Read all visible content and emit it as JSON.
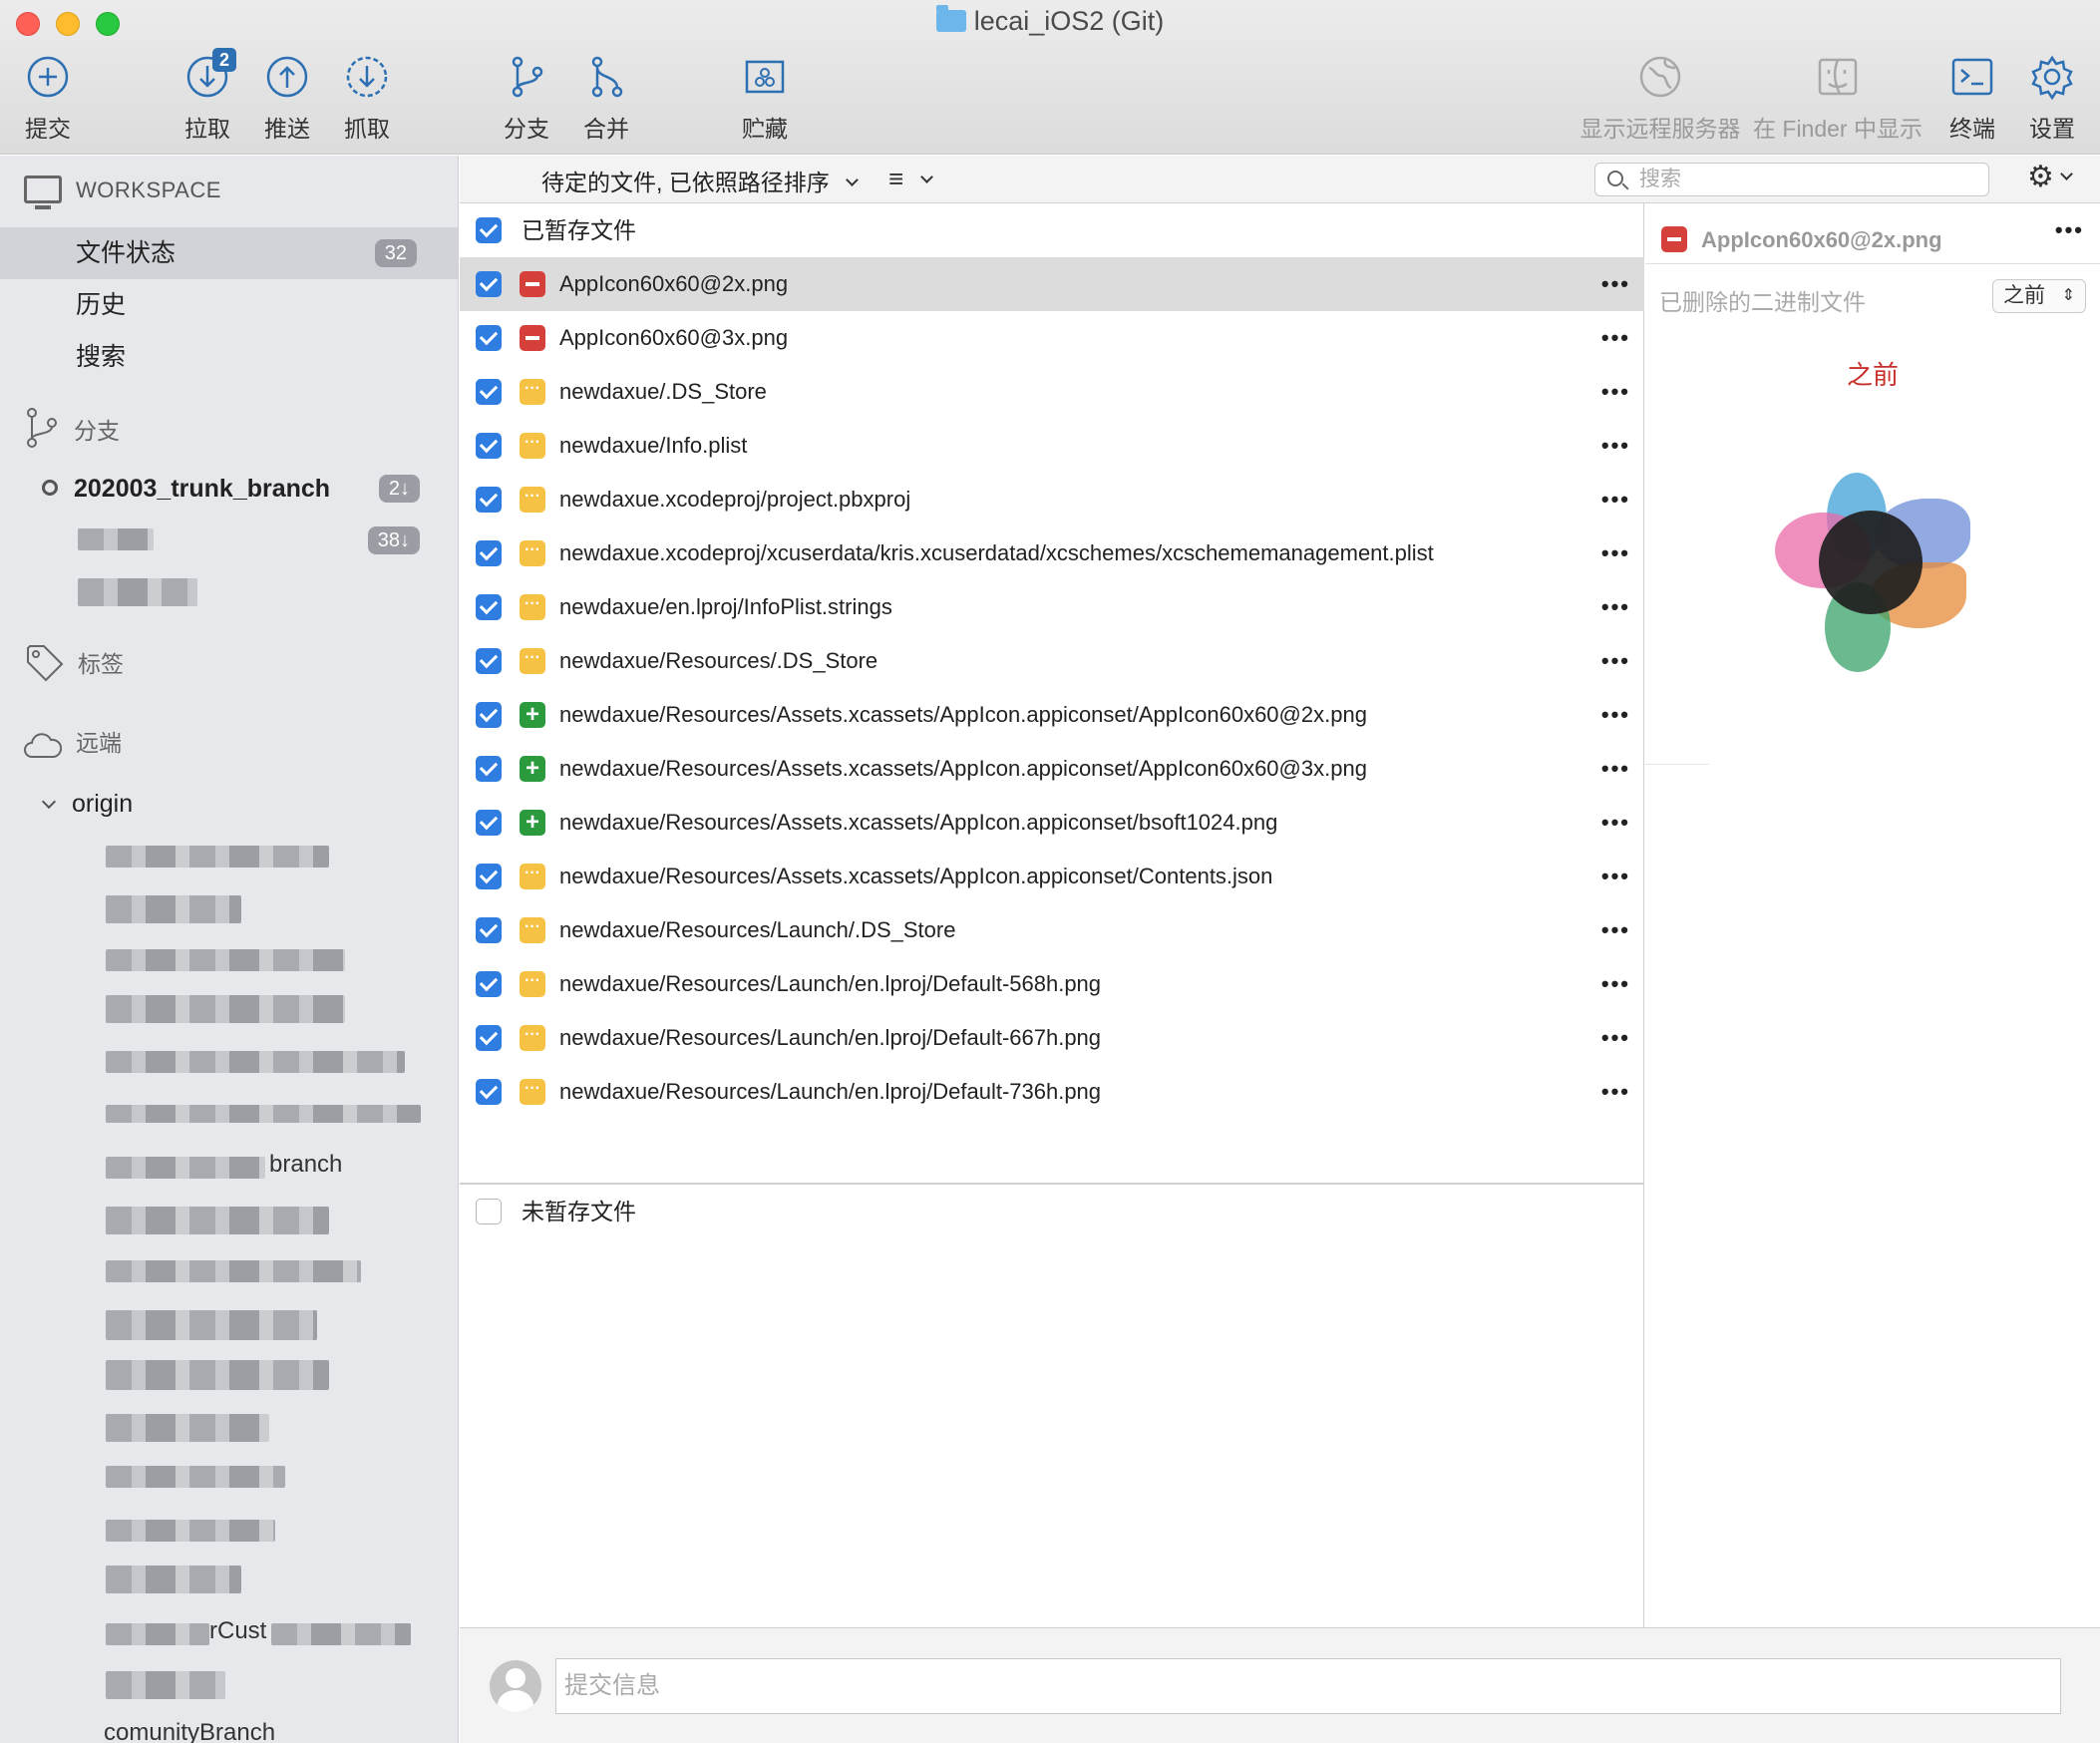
{
  "window": {
    "title": "lecai_iOS2 (Git)"
  },
  "toolbar": {
    "commit": "提交",
    "pull": "拉取",
    "pull_badge": "2",
    "push": "推送",
    "fetch": "抓取",
    "branch": "分支",
    "merge": "合并",
    "stash": "贮藏",
    "show_remote": "显示远程服务器",
    "show_finder": "在 Finder 中显示",
    "terminal": "终端",
    "settings": "设置"
  },
  "sidebar": {
    "workspace": "WORKSPACE",
    "items": [
      {
        "label": "文件状态",
        "count": "32"
      },
      {
        "label": "历史"
      },
      {
        "label": "搜索"
      }
    ],
    "branches_label": "分支",
    "current_branch": "202003_trunk_branch",
    "current_branch_count": "2↓",
    "second_branch_count": "38↓",
    "tags_label": "标签",
    "remotes_label": "远端",
    "origin_label": "origin",
    "partial_names": [
      "branch",
      "rCust",
      "comunityBranch"
    ]
  },
  "filter": {
    "sort_label": "待定的文件, 已依照路径排序",
    "search_placeholder": "搜索"
  },
  "staged": {
    "header": "已暂存文件",
    "files": [
      {
        "status": "deleted",
        "name": "AppIcon60x60@2x.png"
      },
      {
        "status": "deleted",
        "name": "AppIcon60x60@3x.png"
      },
      {
        "status": "modified",
        "name": "newdaxue/.DS_Store"
      },
      {
        "status": "modified",
        "name": "newdaxue/Info.plist"
      },
      {
        "status": "modified",
        "name": "newdaxue.xcodeproj/project.pbxproj"
      },
      {
        "status": "modified",
        "name": "newdaxue.xcodeproj/xcuserdata/kris.xcuserdatad/xcschemes/xcschememanagement.plist"
      },
      {
        "status": "modified",
        "name": "newdaxue/en.lproj/InfoPlist.strings"
      },
      {
        "status": "modified",
        "name": "newdaxue/Resources/.DS_Store"
      },
      {
        "status": "added",
        "name": "newdaxue/Resources/Assets.xcassets/AppIcon.appiconset/AppIcon60x60@2x.png"
      },
      {
        "status": "added",
        "name": "newdaxue/Resources/Assets.xcassets/AppIcon.appiconset/AppIcon60x60@3x.png"
      },
      {
        "status": "added",
        "name": "newdaxue/Resources/Assets.xcassets/AppIcon.appiconset/bsoft1024.png"
      },
      {
        "status": "modified",
        "name": "newdaxue/Resources/Assets.xcassets/AppIcon.appiconset/Contents.json"
      },
      {
        "status": "modified",
        "name": "newdaxue/Resources/Launch/.DS_Store"
      },
      {
        "status": "modified",
        "name": "newdaxue/Resources/Launch/en.lproj/Default-568h.png"
      },
      {
        "status": "modified",
        "name": "newdaxue/Resources/Launch/en.lproj/Default-667h.png"
      },
      {
        "status": "modified",
        "name": "newdaxue/Resources/Launch/en.lproj/Default-736h.png"
      }
    ]
  },
  "unstaged": {
    "header": "未暂存文件"
  },
  "preview": {
    "filename": "AppIcon60x60@2x.png",
    "subtitle": "已删除的二进制文件",
    "mode": "之前",
    "before_label": "之前"
  },
  "commit": {
    "placeholder": "提交信息"
  }
}
